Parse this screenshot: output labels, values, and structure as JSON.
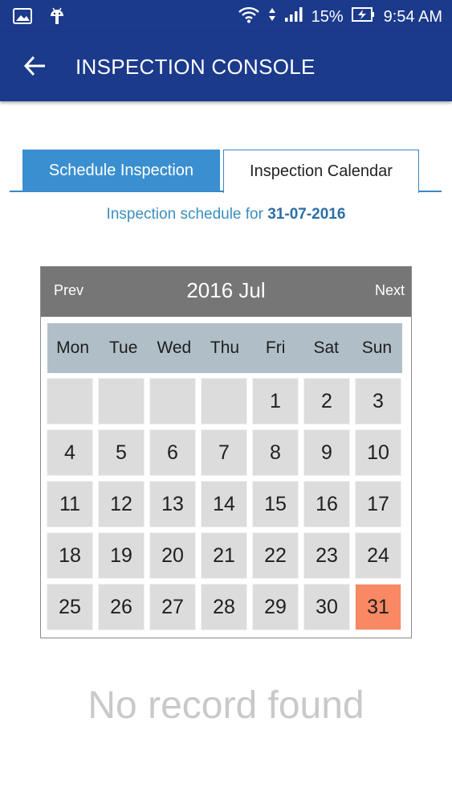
{
  "status_bar": {
    "battery": "15%",
    "time": "9:54 AM",
    "icons": [
      "image-icon",
      "android-icon",
      "wifi-icon",
      "signal-icon",
      "battery-charging-icon"
    ]
  },
  "app_bar": {
    "title": "INSPECTION CONSOLE",
    "back_icon": "arrow-left-icon"
  },
  "tabs": [
    {
      "label": "Schedule Inspection",
      "active": false
    },
    {
      "label": "Inspection Calendar",
      "active": true
    }
  ],
  "subtitle": {
    "prefix": "Inspection schedule for ",
    "date": "31-07-2016"
  },
  "calendar": {
    "prev_label": "Prev",
    "next_label": "Next",
    "month_label": "2016 Jul",
    "weekdays": [
      "Mon",
      "Tue",
      "Wed",
      "Thu",
      "Fri",
      "Sat",
      "Sun"
    ],
    "weeks": [
      [
        "",
        "",
        "",
        "",
        "1",
        "2",
        "3"
      ],
      [
        "4",
        "5",
        "6",
        "7",
        "8",
        "9",
        "10"
      ],
      [
        "11",
        "12",
        "13",
        "14",
        "15",
        "16",
        "17"
      ],
      [
        "18",
        "19",
        "20",
        "21",
        "22",
        "23",
        "24"
      ],
      [
        "25",
        "26",
        "27",
        "28",
        "29",
        "30",
        "31"
      ]
    ],
    "selected_day": "31",
    "selected_color": "#f98864"
  },
  "empty_message": "No record found",
  "colors": {
    "primary": "#1b3a8c",
    "tab_active_fill": "#3a8fd0",
    "accent_text": "#3a8fc0"
  }
}
